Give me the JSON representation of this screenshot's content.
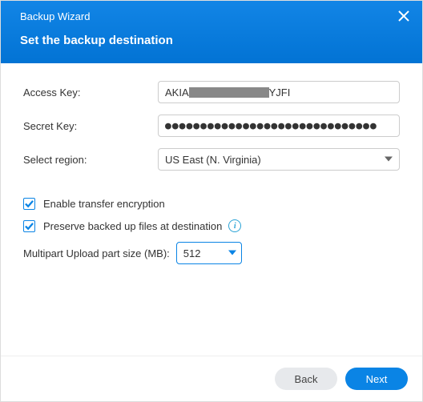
{
  "header": {
    "title": "Backup Wizard",
    "subtitle": "Set the backup destination"
  },
  "form": {
    "access_key": {
      "label": "Access Key:",
      "value_prefix": "AKIA",
      "value_suffix": "YJFI"
    },
    "secret_key": {
      "label": "Secret Key:",
      "masked": "●●●●●●●●●●●●●●●●●●●●●●●●●●●●●●"
    },
    "region": {
      "label": "Select region:",
      "value": "US East (N. Virginia)"
    },
    "enable_encryption": {
      "label": "Enable transfer encryption",
      "checked": true
    },
    "preserve_files": {
      "label": "Preserve backed up files at destination",
      "checked": true
    },
    "multipart": {
      "label": "Multipart Upload part size (MB):",
      "value": "512"
    }
  },
  "footer": {
    "back": "Back",
    "next": "Next"
  }
}
